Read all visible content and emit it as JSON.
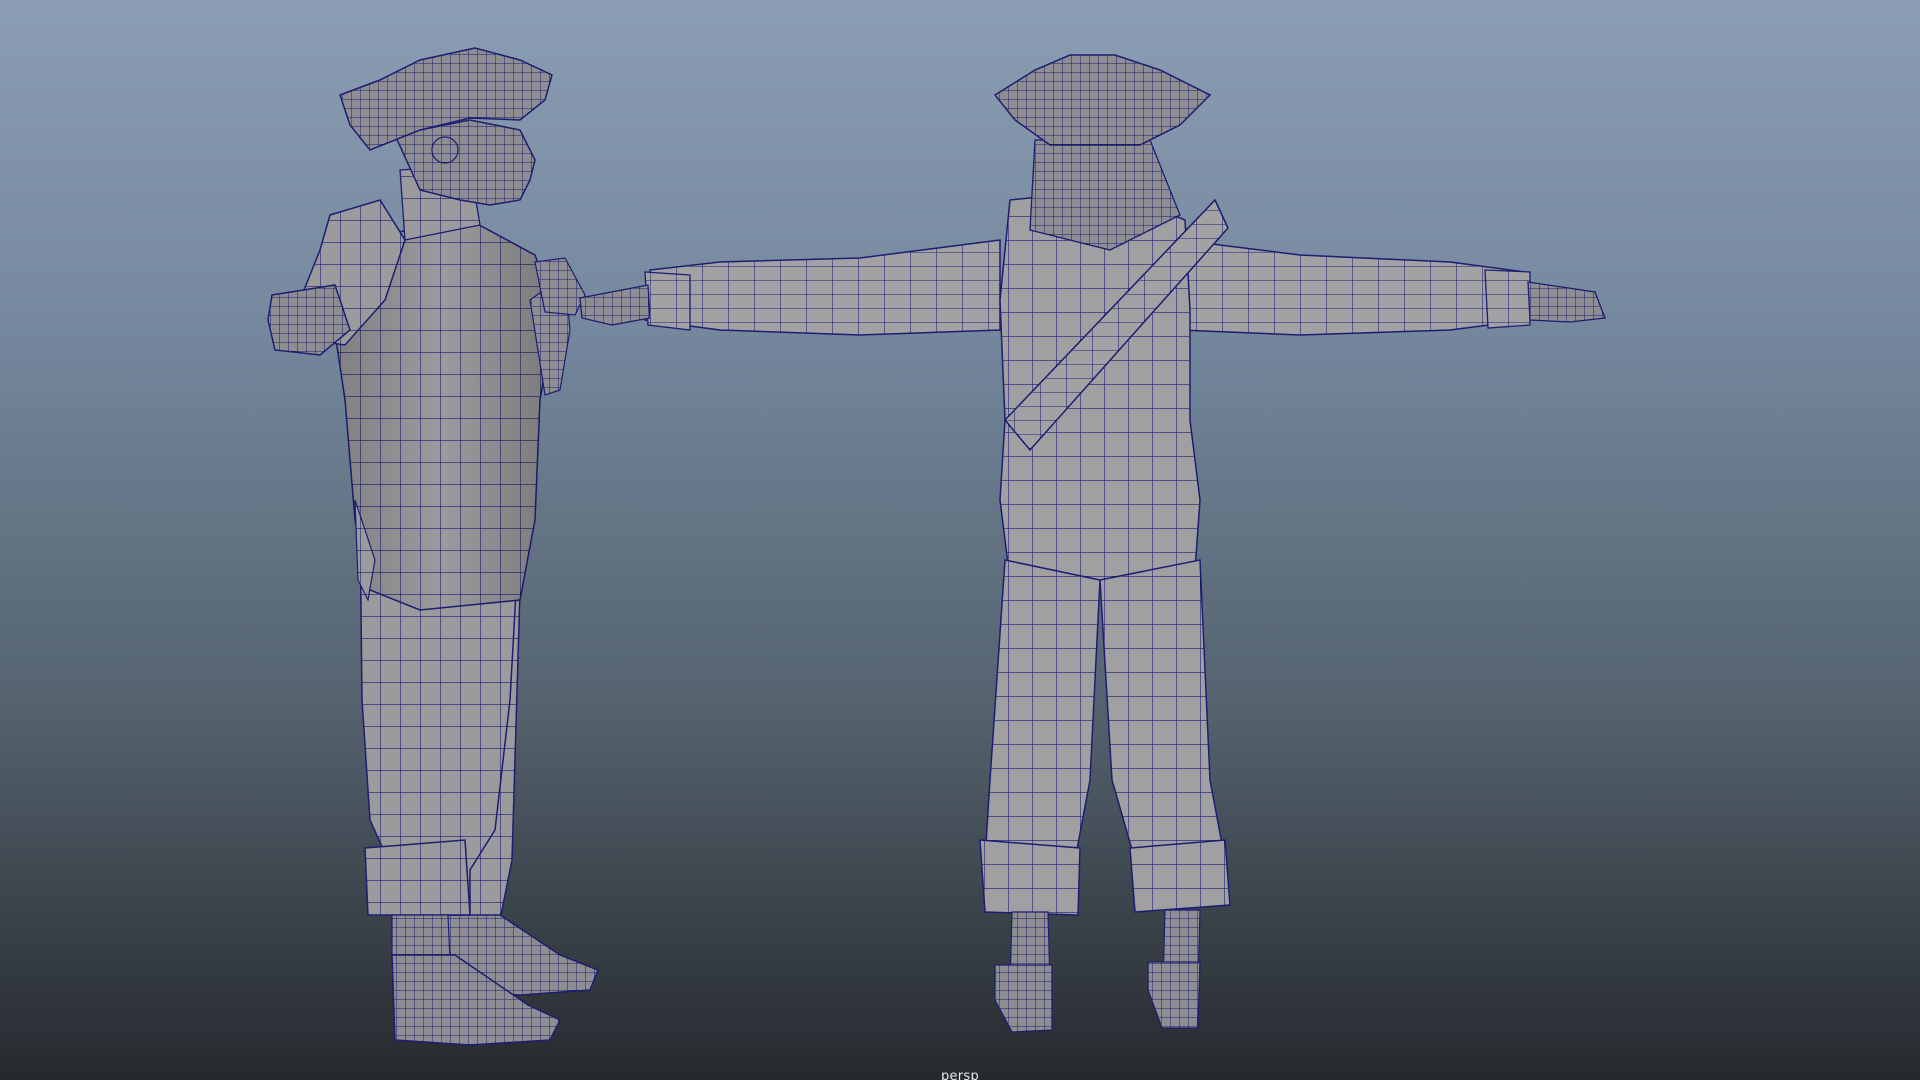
{
  "viewport": {
    "camera_label": "persp",
    "background_top": "#8a9db3",
    "background_bottom": "#262a2f"
  },
  "mesh": {
    "fill_color": "#9a9a9c",
    "shade_color": "#6c6d72",
    "wire_color": "#1d1d72"
  }
}
